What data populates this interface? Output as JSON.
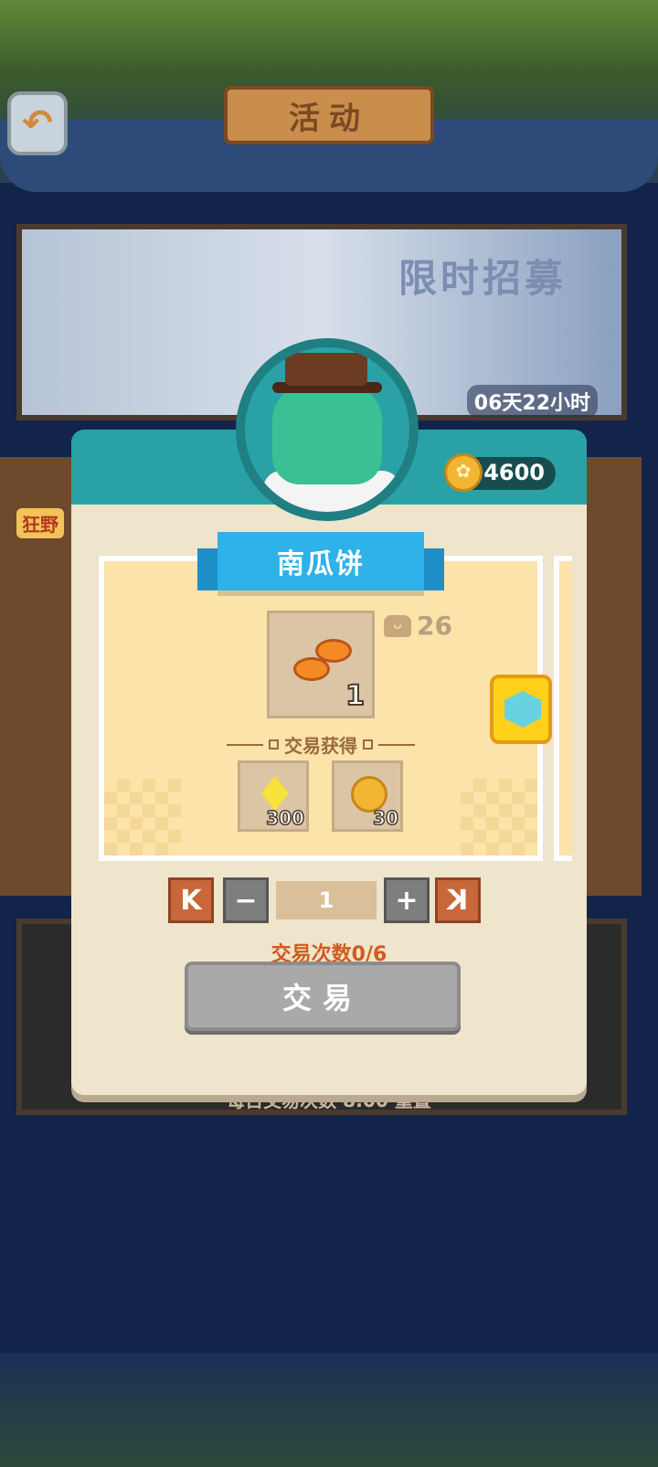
{
  "header": {
    "title": "活动",
    "back_icon": "back-arrow-icon"
  },
  "banner": {
    "title": "限时招募",
    "timer": "06天22小时"
  },
  "side_tag": "狂野",
  "dialog": {
    "coin_balance": "4600",
    "item_name": "南瓜饼",
    "item_count": "1",
    "stock": "26",
    "gain_label": "交易获得",
    "rewards": [
      {
        "icon": "diamond-icon",
        "count": "300"
      },
      {
        "icon": "gold-coin-icon",
        "count": "30"
      }
    ],
    "stepper": {
      "first": "K",
      "minus": "−",
      "value": "1",
      "plus": "+",
      "last": "K"
    },
    "trade_count": "交易次数0/6",
    "trade_button": "交易"
  },
  "footer_note": "每日交易次数 8:00 重置",
  "colors": {
    "teal": "#2aa2a5",
    "ribbon": "#2fb1ea",
    "card": "#fbe3a9",
    "orange_text": "#d15a1e"
  }
}
